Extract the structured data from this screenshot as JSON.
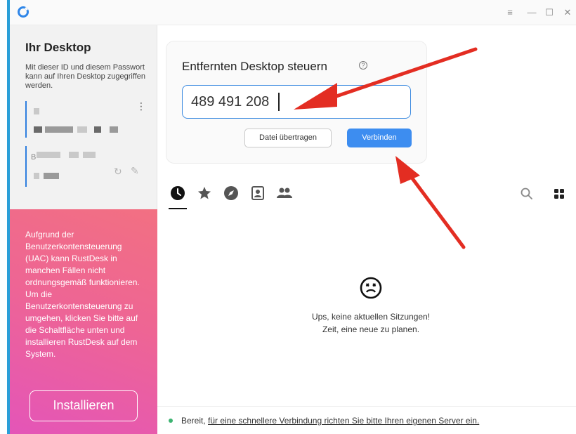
{
  "window": {
    "controls": [
      "≡",
      "—",
      "☐",
      "✕"
    ]
  },
  "sidebar": {
    "title": "Ihr Desktop",
    "description": "Mit dieser ID und diesem Passwort kann auf Ihren Desktop zugegriffen werden.",
    "password_prefix": "B",
    "uac_message": "Aufgrund der Benutzerkontensteuerung (UAC) kann RustDesk in manchen Fällen nicht ordnungsgemäß funktionieren. Um die Benutzerkontensteuerung zu umgehen, klicken Sie bitte auf die Schaltfläche unten und installieren RustDesk auf dem System.",
    "install_label": "Installieren"
  },
  "connect": {
    "title": "Entfernten Desktop steuern",
    "id_value": "489 491 208",
    "transfer_label": "Datei übertragen",
    "connect_label": "Verbinden"
  },
  "tabs": [
    {
      "icon": "clock-icon",
      "active": true
    },
    {
      "icon": "star-icon",
      "active": false
    },
    {
      "icon": "compass-icon",
      "active": false
    },
    {
      "icon": "address-book-icon",
      "active": false
    },
    {
      "icon": "group-icon",
      "active": false
    }
  ],
  "empty_state": {
    "line1": "Ups, keine aktuellen Sitzungen!",
    "line2": "Zeit, eine neue zu planen."
  },
  "status": {
    "ready": "Bereit,",
    "link": "für eine schnellere Verbindung richten Sie bitte Ihren eigenen Server ein."
  },
  "colors": {
    "accent": "#3d8df0",
    "status_ok": "#3cb371",
    "annotation": "#e32d22",
    "uac_gradient_start": "#f27082",
    "uac_gradient_end": "#e455b8"
  }
}
